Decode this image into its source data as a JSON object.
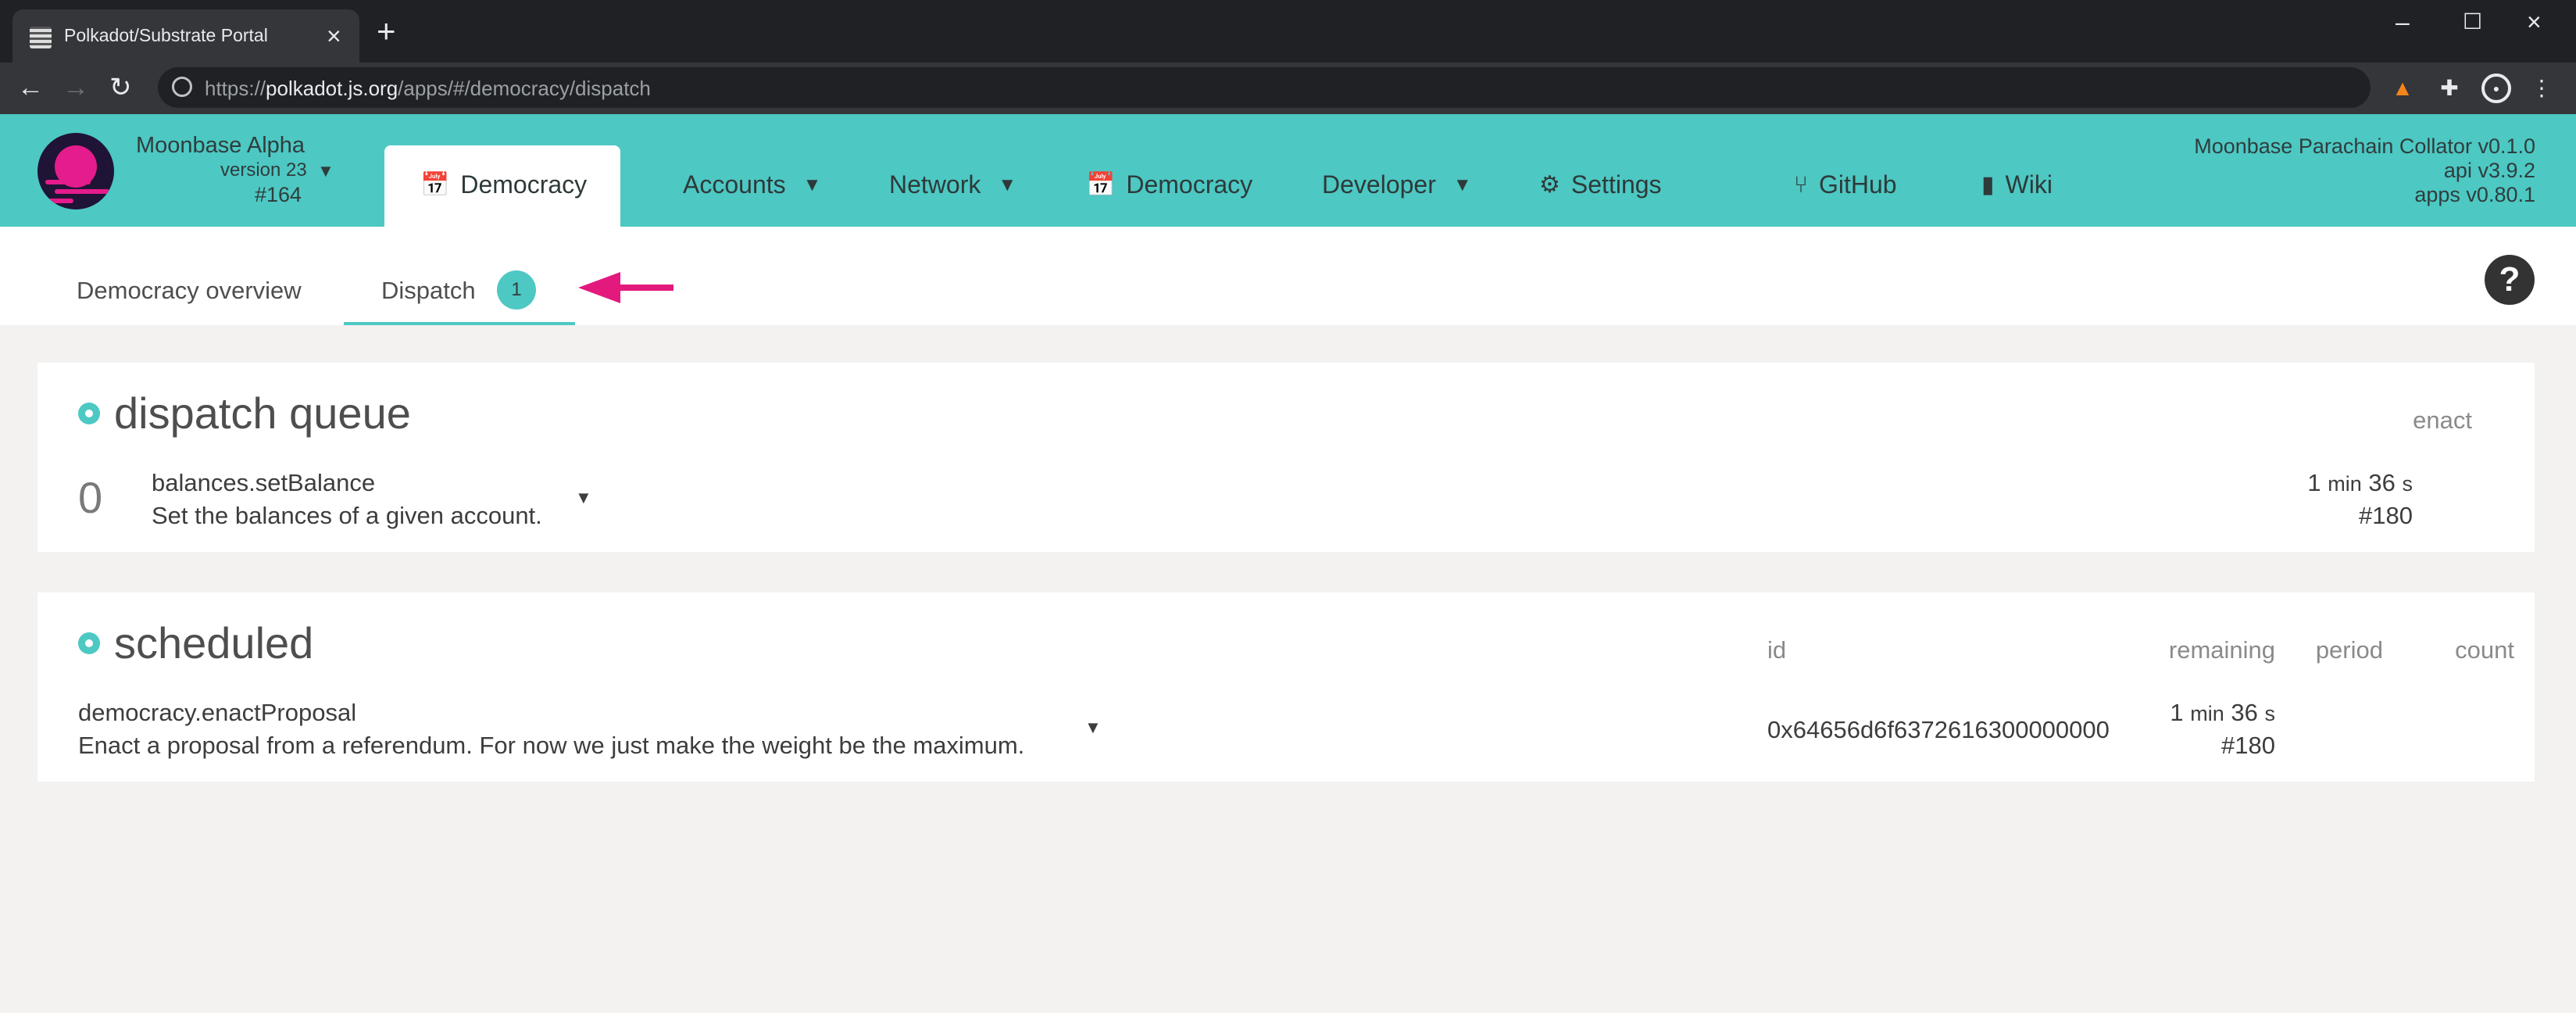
{
  "browser": {
    "tab_title": "Polkadot/Substrate Portal",
    "url_scheme": "https://",
    "url_host": "polkadot.js.org",
    "url_path": "/apps/#/democracy/dispatch"
  },
  "header": {
    "chain_name": "Moonbase Alpha",
    "chain_version": "version 23",
    "block_number": "#164",
    "active_tab": "Democracy",
    "menu": {
      "accounts": "Accounts",
      "network": "Network",
      "democracy": "Democracy",
      "developer": "Developer",
      "settings": "Settings",
      "github": "GitHub",
      "wiki": "Wiki"
    },
    "versions": {
      "node": "Moonbase Parachain Collator v0.1.0",
      "api": "api v3.9.2",
      "apps": "apps v0.80.1"
    }
  },
  "subtabs": {
    "overview": "Democracy overview",
    "dispatch": "Dispatch",
    "dispatch_count": "1"
  },
  "dispatch_queue": {
    "title": "dispatch queue",
    "col_enact": "enact",
    "rows": [
      {
        "index": "0",
        "call": "balances.setBalance",
        "doc": "Set the balances of a given account.",
        "enact_num1": "1",
        "enact_unit1": "min",
        "enact_num2": "36",
        "enact_unit2": "s",
        "enact_block": "#180"
      }
    ]
  },
  "scheduled": {
    "title": "scheduled",
    "col_id": "id",
    "col_remaining": "remaining",
    "col_period": "period",
    "col_count": "count",
    "rows": [
      {
        "call": "democracy.enactProposal",
        "doc": "Enact a proposal from a referendum. For now we just make the weight be the maximum.",
        "id": "0x64656d6f6372616300000000",
        "remaining_num1": "1",
        "remaining_unit1": "min",
        "remaining_num2": "36",
        "remaining_unit2": "s",
        "remaining_block": "#180"
      }
    ]
  },
  "colors": {
    "accent": "#4dc8c3",
    "arrow": "#e4197d",
    "logo_bg": "#1f1336",
    "logo_fg": "#e51c8b"
  }
}
